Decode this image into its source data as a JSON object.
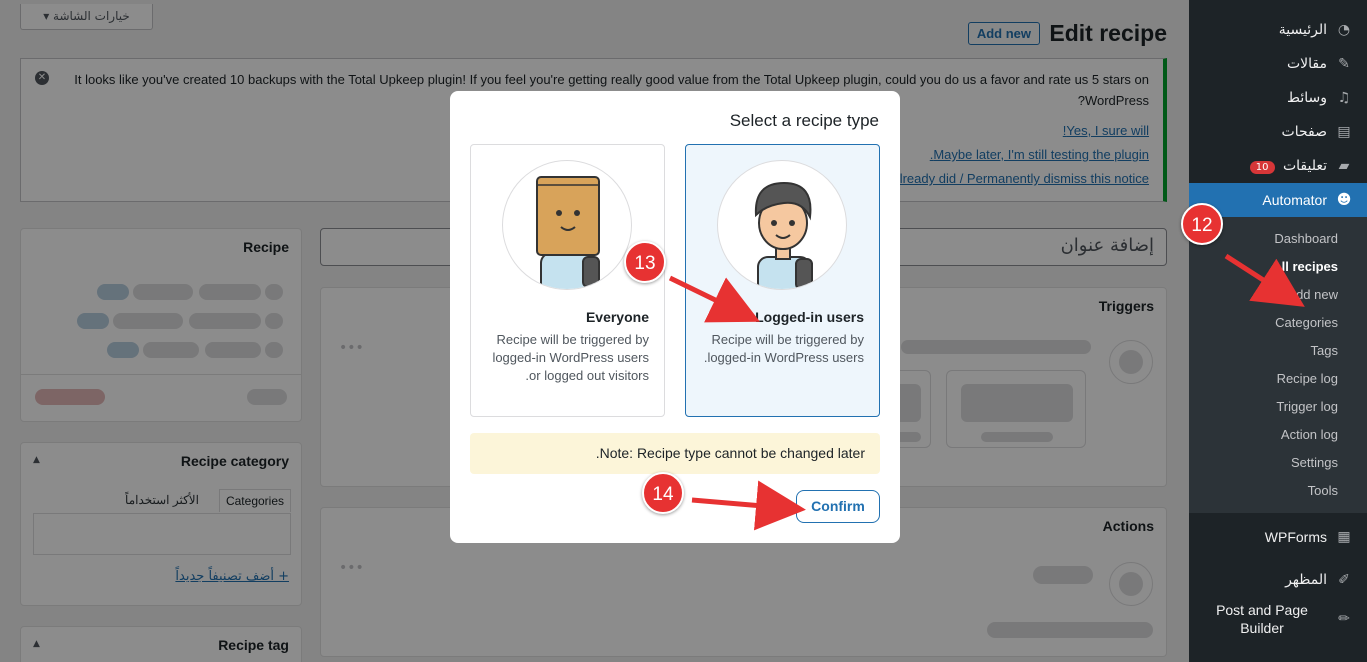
{
  "sidebar": {
    "items": [
      {
        "label": "الرئيسية",
        "icon": "dashboard-icon"
      },
      {
        "label": "مقالات",
        "icon": "pin-icon"
      },
      {
        "label": "وسائط",
        "icon": "media-icon"
      },
      {
        "label": "صفحات",
        "icon": "pages-icon"
      },
      {
        "label": "تعليقات",
        "icon": "comments-icon",
        "badge": "10"
      },
      {
        "label": "Automator",
        "icon": "automator-icon"
      }
    ],
    "automator_submenu": [
      "Dashboard",
      "All recipes",
      "Add new",
      "Categories",
      "Tags",
      "Recipe log",
      "Trigger log",
      "Action log",
      "Settings",
      "Tools"
    ],
    "lower_items": [
      {
        "label": "WPForms",
        "icon": "wpforms-icon"
      },
      {
        "label": "المظهر",
        "icon": "appearance-icon"
      },
      {
        "label": "Post and Page Builder",
        "icon": "pencil-icon"
      }
    ]
  },
  "header": {
    "screen_options": "خيارات الشاشة ▾",
    "title": "Edit recipe",
    "add_new": "Add new"
  },
  "notice": {
    "text": "It looks like you've created 10 backups with the Total Upkeep plugin! If you feel you're getting really good value from the Total Upkeep plugin, could you do us a favor and rate us 5 stars on WordPress?",
    "links": [
      "Yes, I sure will!",
      "Maybe later, I'm still testing the plugin.",
      "I already did / Permanently dismiss this notice"
    ]
  },
  "editor": {
    "title_placeholder": "إضافة عنوان",
    "triggers_label": "Triggers",
    "actions_label": "Actions"
  },
  "side_boxes": {
    "recipe": "Recipe",
    "recipe_category": "Recipe category",
    "categories_tab": "Categories",
    "most_used_tab": "الأكثر استخداماً",
    "add_category": "+ أضف تصنيفاً جديداً",
    "recipe_tag": "Recipe tag"
  },
  "modal": {
    "title": "Select a recipe type",
    "options": [
      {
        "name": "Everyone",
        "desc": "Recipe will be triggered by logged-in WordPress users or logged out visitors."
      },
      {
        "name": "Logged-in users",
        "desc": "Recipe will be triggered by logged-in WordPress users."
      }
    ],
    "note": "Note: Recipe type cannot be changed later.",
    "confirm": "Confirm"
  },
  "steps": [
    "12",
    "13",
    "14"
  ],
  "colors": {
    "accent": "#2271b1",
    "marker": "#e73232",
    "sidebar": "#1d2327"
  }
}
